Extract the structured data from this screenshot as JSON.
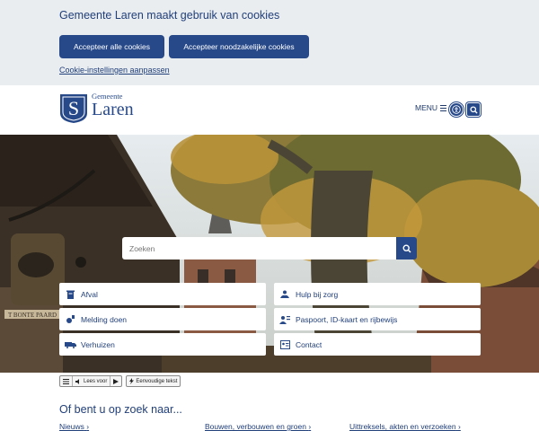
{
  "cookie_banner": {
    "title": "Gemeente Laren maakt gebruik van cookies",
    "accept_all_label": "Accepteer alle cookies",
    "accept_necessary_label": "Accepteer noodzakelijke cookies",
    "settings_link": "Cookie-instellingen aanpassen"
  },
  "header": {
    "logo_small": "Gemeente",
    "logo_big": "Laren",
    "menu_label": "MENU"
  },
  "search": {
    "placeholder": "Zoeken"
  },
  "quick_links": {
    "left": [
      "Afval",
      "Melding doen",
      "Verhuizen"
    ],
    "right": [
      "Hulp bij zorg",
      "Paspoort, ID-kaart en rijbewijs",
      "Contact"
    ]
  },
  "readspeaker": {
    "read_label": "Lees voor",
    "easy_text_label": "Eenvoudige tekst"
  },
  "section": {
    "title": "Of bent u op zoek naar...",
    "links": [
      "Nieuws",
      "Bouwen, verbouwen en groen",
      "Uittreksels, akten en verzoeken"
    ]
  },
  "colors": {
    "brand": "#27498a",
    "banner_bg": "#e9edf0"
  }
}
